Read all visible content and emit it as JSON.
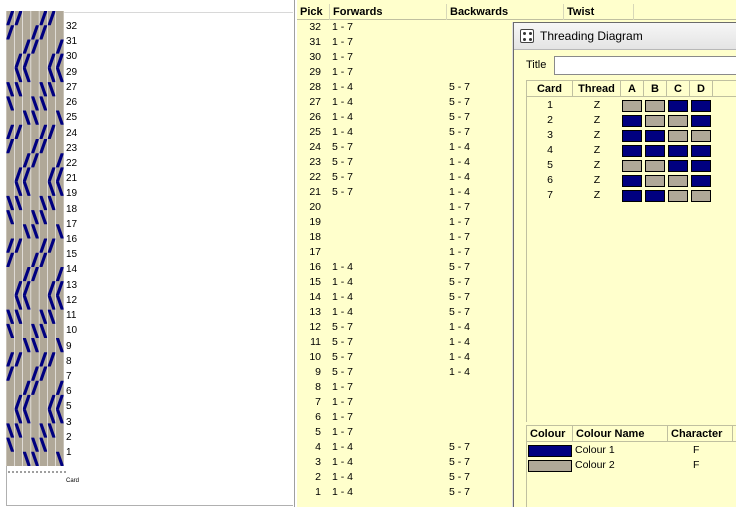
{
  "colors": {
    "blue": "#000080",
    "tan": "#b0a898",
    "pane_bg": "#ffffcc"
  },
  "pattern": {
    "row_labels": [
      "32",
      "31",
      "30",
      "29",
      "27",
      "26",
      "25",
      "24",
      "23",
      "22",
      "21",
      "19",
      "18",
      "17",
      "16",
      "15",
      "14",
      "13",
      "12",
      "11",
      "10",
      "9",
      "8",
      "7",
      "6",
      "5",
      "3",
      "2",
      "1"
    ],
    "card_label": "Card"
  },
  "pick_table": {
    "headers": {
      "pick": "Pick",
      "forwards": "Forwards",
      "backwards": "Backwards",
      "twist": "Twist"
    },
    "rows": [
      {
        "pick": "32",
        "fw": "1 - 7",
        "bw": ""
      },
      {
        "pick": "31",
        "fw": "1 - 7",
        "bw": ""
      },
      {
        "pick": "30",
        "fw": "1 - 7",
        "bw": ""
      },
      {
        "pick": "29",
        "fw": "1 - 7",
        "bw": ""
      },
      {
        "pick": "28",
        "fw": "1 - 4",
        "bw": "5 - 7"
      },
      {
        "pick": "27",
        "fw": "1 - 4",
        "bw": "5 - 7"
      },
      {
        "pick": "26",
        "fw": "1 - 4",
        "bw": "5 - 7"
      },
      {
        "pick": "25",
        "fw": "1 - 4",
        "bw": "5 - 7"
      },
      {
        "pick": "24",
        "fw": "5 - 7",
        "bw": "1 - 4"
      },
      {
        "pick": "23",
        "fw": "5 - 7",
        "bw": "1 - 4"
      },
      {
        "pick": "22",
        "fw": "5 - 7",
        "bw": "1 - 4"
      },
      {
        "pick": "21",
        "fw": "5 - 7",
        "bw": "1 - 4"
      },
      {
        "pick": "20",
        "fw": "",
        "bw": "1 - 7"
      },
      {
        "pick": "19",
        "fw": "",
        "bw": "1 - 7"
      },
      {
        "pick": "18",
        "fw": "",
        "bw": "1 - 7"
      },
      {
        "pick": "17",
        "fw": "",
        "bw": "1 - 7"
      },
      {
        "pick": "16",
        "fw": "1 - 4",
        "bw": "5 - 7"
      },
      {
        "pick": "15",
        "fw": "1 - 4",
        "bw": "5 - 7"
      },
      {
        "pick": "14",
        "fw": "1 - 4",
        "bw": "5 - 7"
      },
      {
        "pick": "13",
        "fw": "1 - 4",
        "bw": "5 - 7"
      },
      {
        "pick": "12",
        "fw": "5 - 7",
        "bw": "1 - 4"
      },
      {
        "pick": "11",
        "fw": "5 - 7",
        "bw": "1 - 4"
      },
      {
        "pick": "10",
        "fw": "5 - 7",
        "bw": "1 - 4"
      },
      {
        "pick": "9",
        "fw": "5 - 7",
        "bw": "1 - 4"
      },
      {
        "pick": "8",
        "fw": "1 - 7",
        "bw": ""
      },
      {
        "pick": "7",
        "fw": "1 - 7",
        "bw": ""
      },
      {
        "pick": "6",
        "fw": "1 - 7",
        "bw": ""
      },
      {
        "pick": "5",
        "fw": "1 - 7",
        "bw": ""
      },
      {
        "pick": "4",
        "fw": "1 - 4",
        "bw": "5 - 7"
      },
      {
        "pick": "3",
        "fw": "1 - 4",
        "bw": "5 - 7"
      },
      {
        "pick": "2",
        "fw": "1 - 4",
        "bw": "5 - 7"
      },
      {
        "pick": "1",
        "fw": "1 - 4",
        "bw": "5 - 7"
      }
    ]
  },
  "threading_window": {
    "title": "Threading Diagram",
    "title_field_label": "Title",
    "title_field_value": "",
    "card_table": {
      "headers": {
        "card": "Card",
        "thread": "Thread",
        "a": "A",
        "b": "B",
        "c": "C",
        "d": "D"
      },
      "rows": [
        {
          "card": "1",
          "thread": "Z",
          "holes": [
            "tan",
            "tan",
            "blue",
            "blue"
          ]
        },
        {
          "card": "2",
          "thread": "Z",
          "holes": [
            "blue",
            "tan",
            "tan",
            "blue"
          ]
        },
        {
          "card": "3",
          "thread": "Z",
          "holes": [
            "blue",
            "blue",
            "tan",
            "tan"
          ]
        },
        {
          "card": "4",
          "thread": "Z",
          "holes": [
            "blue",
            "blue",
            "blue",
            "blue"
          ]
        },
        {
          "card": "5",
          "thread": "Z",
          "holes": [
            "tan",
            "tan",
            "blue",
            "blue"
          ]
        },
        {
          "card": "6",
          "thread": "Z",
          "holes": [
            "blue",
            "tan",
            "tan",
            "blue"
          ]
        },
        {
          "card": "7",
          "thread": "Z",
          "holes": [
            "blue",
            "blue",
            "tan",
            "tan"
          ]
        }
      ]
    },
    "colour_table": {
      "headers": {
        "colour": "Colour",
        "colour_name": "Colour Name",
        "character": "Character"
      },
      "rows": [
        {
          "name": "Colour 1",
          "character": "F",
          "color": "blue"
        },
        {
          "name": "Colour 2",
          "character": "F",
          "color": "tan"
        }
      ]
    }
  }
}
